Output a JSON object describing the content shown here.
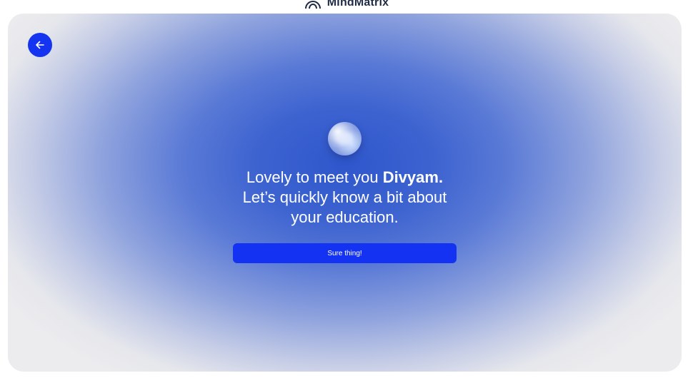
{
  "brand": {
    "name": "MindMatrix",
    "logo_icon": "arch-logo-icon"
  },
  "back": {
    "icon": "arrow-left-icon",
    "color": "#1434f0"
  },
  "greeting": {
    "line1_prefix": "Lovely to meet you ",
    "name": "Divyam",
    "name_suffix": ".",
    "line2": "Let’s quickly know a bit about",
    "line3": "your education."
  },
  "cta": {
    "label": "Sure thing!",
    "color": "#1432f2"
  },
  "colors": {
    "accent": "#1434f0",
    "gradient_center": "#2f57cc",
    "card_edge": "#ececee"
  }
}
